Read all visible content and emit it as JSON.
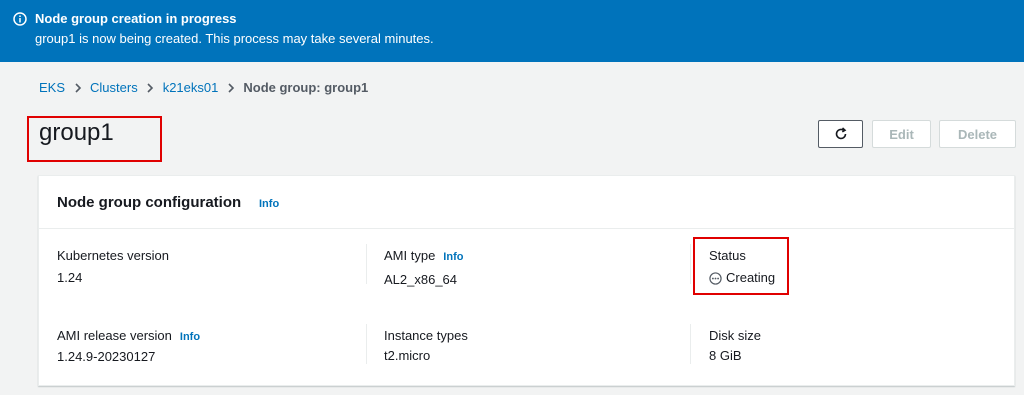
{
  "flash": {
    "title": "Node group creation in progress",
    "message": "group1 is now being created. This process may take several minutes.",
    "icon": "info-icon"
  },
  "breadcrumb": [
    {
      "label": "EKS"
    },
    {
      "label": "Clusters"
    },
    {
      "label": "k21eks01"
    },
    {
      "label": "Node group: group1"
    }
  ],
  "page": {
    "title": "group1"
  },
  "actions": {
    "refresh_icon": "refresh-icon",
    "edit": "Edit",
    "delete": "Delete"
  },
  "config": {
    "title": "Node group configuration",
    "info": "Info",
    "fields": {
      "k8s_version": {
        "label": "Kubernetes version",
        "value": "1.24"
      },
      "ami_type": {
        "label": "AMI type",
        "value": "AL2_x86_64",
        "info": "Info"
      },
      "status": {
        "label": "Status",
        "value": "Creating"
      },
      "ami_release": {
        "label": "AMI release version",
        "value": "1.24.9-20230127",
        "info": "Info"
      },
      "instance_types": {
        "label": "Instance types",
        "value": "t2.micro"
      },
      "disk_size": {
        "label": "Disk size",
        "value": "8 GiB"
      }
    }
  },
  "colors": {
    "flash_bg": "#0073bb",
    "link": "#0073bb",
    "annotation": "#e00000"
  }
}
